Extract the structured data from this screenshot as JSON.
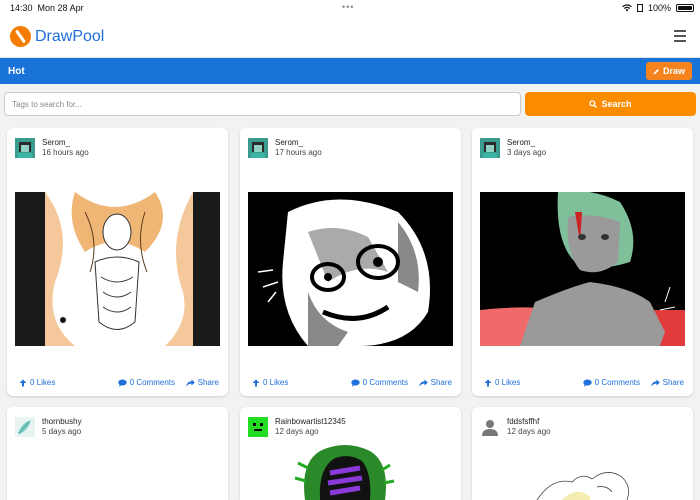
{
  "status": {
    "time": "14:30",
    "date": "Mon 28 Apr",
    "battery": "100%"
  },
  "nav": {
    "brand": "DrawPool"
  },
  "hotbar": {
    "title": "Hot",
    "draw_label": "Draw"
  },
  "search": {
    "placeholder": "Tags to search for...",
    "button_label": "Search"
  },
  "colors": {
    "brand_blue": "#1a73d9",
    "accent_orange": "#fb8c00",
    "link_blue": "#1e6fd9"
  },
  "posts": [
    {
      "user": "Serom_",
      "time": "16 hours ago",
      "likes": "0 Likes",
      "comments": "0 Comments",
      "share": "Share"
    },
    {
      "user": "Serom_",
      "time": "17 hours ago",
      "likes": "0 Likes",
      "comments": "0 Comments",
      "share": "Share"
    },
    {
      "user": "Serom_",
      "time": "3 days ago",
      "likes": "0 Likes",
      "comments": "0 Comments",
      "share": "Share"
    },
    {
      "user": "thornbushy",
      "time": "5 days ago"
    },
    {
      "user": "Rainbowartist12345",
      "time": "12 days ago"
    },
    {
      "user": "fddsfsffhf",
      "time": "12 days ago"
    }
  ]
}
